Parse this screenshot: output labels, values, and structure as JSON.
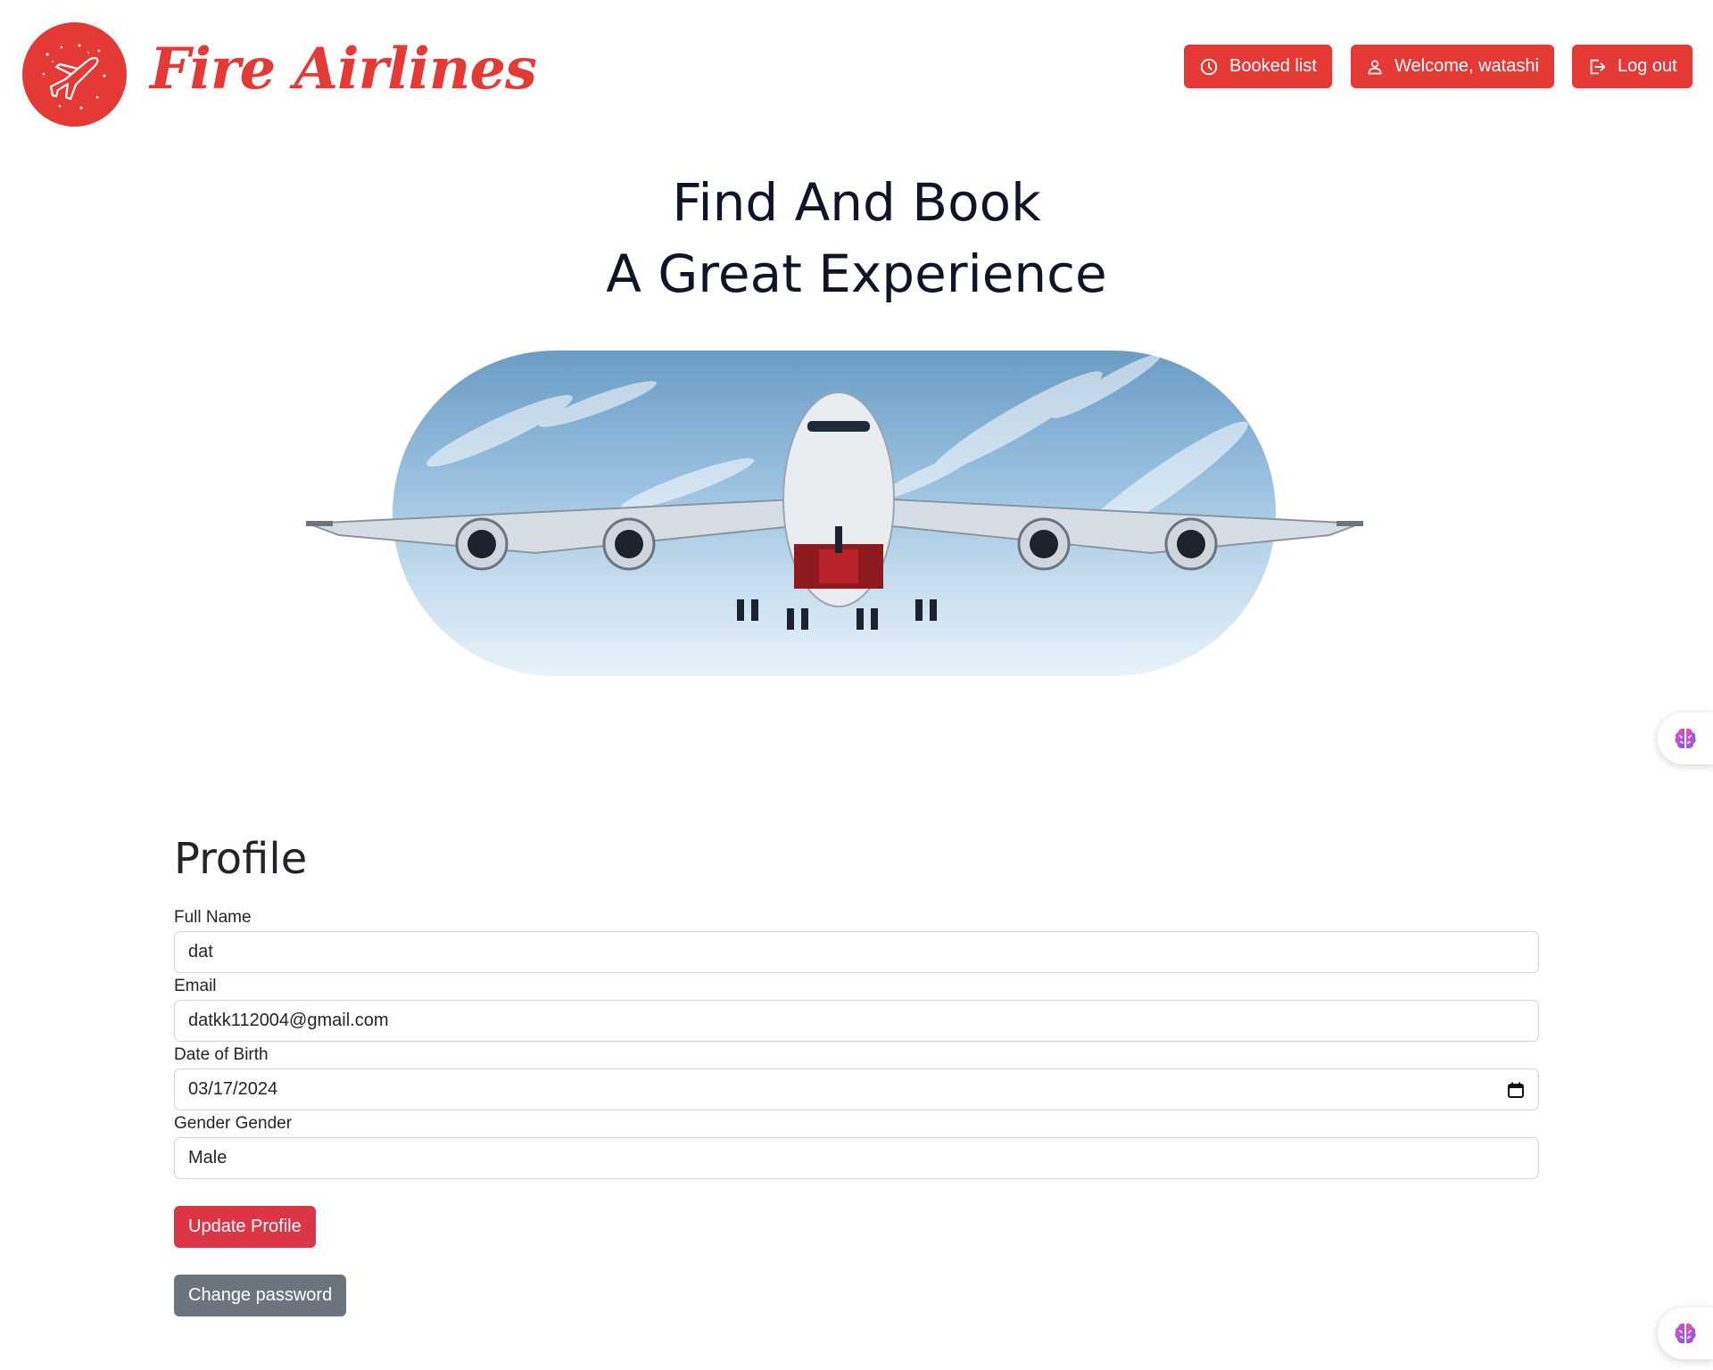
{
  "header": {
    "brand": "Fire Airlines",
    "nav": {
      "booked_list": "Booked list",
      "welcome": "Welcome, watashi",
      "logout": "Log out"
    }
  },
  "hero": {
    "line1": "Find And Book",
    "line2": "A Great Experience"
  },
  "profile": {
    "title": "Profile",
    "fields": {
      "full_name": {
        "label": "Full Name",
        "value": "dat"
      },
      "email": {
        "label": "Email",
        "value": "datkk112004@gmail.com"
      },
      "dob": {
        "label": "Date of Birth",
        "value": "03/17/2024"
      },
      "gender": {
        "label": "Gender Gender",
        "value": "Male"
      }
    },
    "update_button": "Update Profile",
    "change_password_button": "Change password"
  },
  "colors": {
    "brand_red": "#e53935",
    "update_red": "#dc3545",
    "secondary_gray": "#6c757d"
  },
  "icons": [
    "airplane-logo-icon",
    "clock-icon",
    "user-icon",
    "logout-icon",
    "calendar-icon",
    "brain-icon"
  ]
}
